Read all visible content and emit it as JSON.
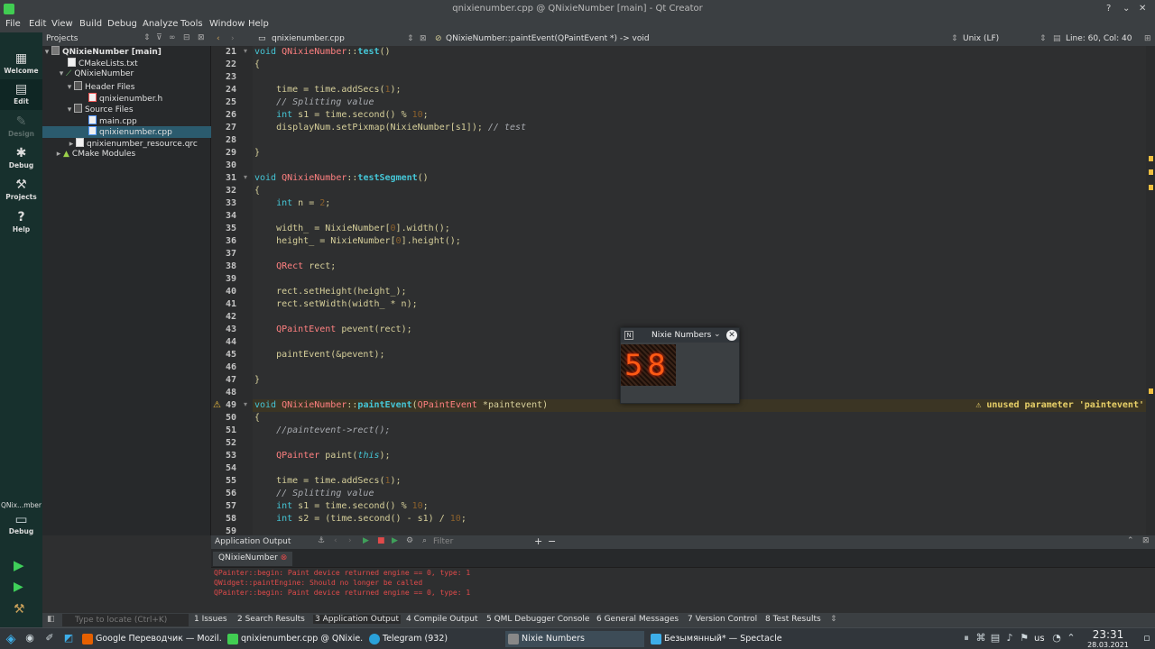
{
  "window": {
    "title": "qnixienumber.cpp @ QNixieNumber [main] - Qt Creator"
  },
  "menu": [
    "File",
    "Edit",
    "View",
    "Build",
    "Debug",
    "Analyze",
    "Tools",
    "Window",
    "Help"
  ],
  "modes": [
    {
      "label": "Welcome",
      "icon": "grid-icon"
    },
    {
      "label": "Edit",
      "icon": "edit-icon"
    },
    {
      "label": "Design",
      "icon": "pencil-icon"
    },
    {
      "label": "Debug",
      "icon": "bug-icon"
    },
    {
      "label": "Projects",
      "icon": "wrench-icon"
    },
    {
      "label": "Help",
      "icon": "help-icon"
    }
  ],
  "kit": {
    "name": "QNix...mber",
    "build": "Debug"
  },
  "projects": {
    "header": "Projects",
    "tree": [
      {
        "label": "QNixieNumber [main]",
        "depth": 0
      },
      {
        "label": "CMakeLists.txt",
        "depth": 1
      },
      {
        "label": "QNixieNumber",
        "depth": 1
      },
      {
        "label": "Header Files",
        "depth": 2
      },
      {
        "label": "qnixienumber.h",
        "depth": 3
      },
      {
        "label": "Source Files",
        "depth": 2
      },
      {
        "label": "main.cpp",
        "depth": 3
      },
      {
        "label": "qnixienumber.cpp",
        "depth": 3
      },
      {
        "label": "qnixienumber_resource.qrc",
        "depth": 1
      },
      {
        "label": "CMake Modules",
        "depth": 0
      }
    ]
  },
  "editor": {
    "file": "qnixienumber.cpp",
    "symbol": "QNixieNumber::paintEvent(QPaintEvent *) -> void",
    "encoding": "Unix (LF)",
    "position": "Line: 60, Col: 40",
    "warning": "unused parameter 'paintevent'",
    "lines": [
      {
        "n": "21",
        "code": "void QNixieNumber::test()"
      },
      {
        "n": "22",
        "code": "{"
      },
      {
        "n": "23",
        "code": ""
      },
      {
        "n": "24",
        "code": "    time = time.addSecs(1);"
      },
      {
        "n": "25",
        "code": "    // Splitting value"
      },
      {
        "n": "26",
        "code": "    int s1 = time.second() % 10;"
      },
      {
        "n": "27",
        "code": "    displayNum.setPixmap(NixieNumber[s1]); // test"
      },
      {
        "n": "28",
        "code": ""
      },
      {
        "n": "29",
        "code": "}"
      },
      {
        "n": "30",
        "code": ""
      },
      {
        "n": "31",
        "code": "void QNixieNumber::testSegment()"
      },
      {
        "n": "32",
        "code": "{"
      },
      {
        "n": "33",
        "code": "    int n = 2;"
      },
      {
        "n": "34",
        "code": ""
      },
      {
        "n": "35",
        "code": "    width_ = NixieNumber[0].width();"
      },
      {
        "n": "36",
        "code": "    height_ = NixieNumber[0].height();"
      },
      {
        "n": "37",
        "code": ""
      },
      {
        "n": "38",
        "code": "    QRect rect;"
      },
      {
        "n": "39",
        "code": ""
      },
      {
        "n": "40",
        "code": "    rect.setHeight(height_);"
      },
      {
        "n": "41",
        "code": "    rect.setWidth(width_ * n);"
      },
      {
        "n": "42",
        "code": ""
      },
      {
        "n": "43",
        "code": "    QPaintEvent pevent(rect);"
      },
      {
        "n": "44",
        "code": ""
      },
      {
        "n": "45",
        "code": "    paintEvent(&pevent);"
      },
      {
        "n": "46",
        "code": ""
      },
      {
        "n": "47",
        "code": "}"
      },
      {
        "n": "48",
        "code": ""
      },
      {
        "n": "49",
        "code": "void QNixieNumber::paintEvent(QPaintEvent *paintevent)"
      },
      {
        "n": "50",
        "code": "{"
      },
      {
        "n": "51",
        "code": "    //paintevent->rect();"
      },
      {
        "n": "52",
        "code": ""
      },
      {
        "n": "53",
        "code": "    QPainter paint(this);"
      },
      {
        "n": "54",
        "code": ""
      },
      {
        "n": "55",
        "code": "    time = time.addSecs(1);"
      },
      {
        "n": "56",
        "code": "    // Splitting value"
      },
      {
        "n": "57",
        "code": "    int s1 = time.second() % 10;"
      },
      {
        "n": "58",
        "code": "    int s2 = (time.second() - s1) / 10;"
      },
      {
        "n": "59",
        "code": ""
      }
    ]
  },
  "output": {
    "header": "Application Output",
    "filter_placeholder": "Filter",
    "tab": "QNixieNumber",
    "lines": [
      "QPainter::begin: Paint device returned engine == 0, type: 1",
      "QWidget::paintEngine: Should no longer be called",
      "QPainter::begin: Paint device returned engine == 0, type: 1"
    ]
  },
  "statusbar": {
    "locator_placeholder": "Type to locate (Ctrl+K)",
    "tabs": [
      "1  Issues",
      "2  Search Results",
      "3  Application Output",
      "4  Compile Output",
      "5  QML Debugger Console",
      "6  General Messages",
      "7  Version Control",
      "8  Test Results"
    ]
  },
  "popup": {
    "title": "Nixie Numbers",
    "digits": "58"
  },
  "taskbar": {
    "tasks": [
      {
        "label": "Google Переводчик — Mozil...",
        "color": "#e66000"
      },
      {
        "label": "qnixienumber.cpp @ QNixie...",
        "color": "#41cd52"
      },
      {
        "label": "Telegram (932)",
        "color": "#2aa1da"
      },
      {
        "label": "Nixie Numbers",
        "color": "#888888"
      },
      {
        "label": "Безымянный* — Spectacle",
        "color": "#3daee9"
      }
    ],
    "layout": "us",
    "time": "23:31",
    "date": "28.03.2021"
  }
}
